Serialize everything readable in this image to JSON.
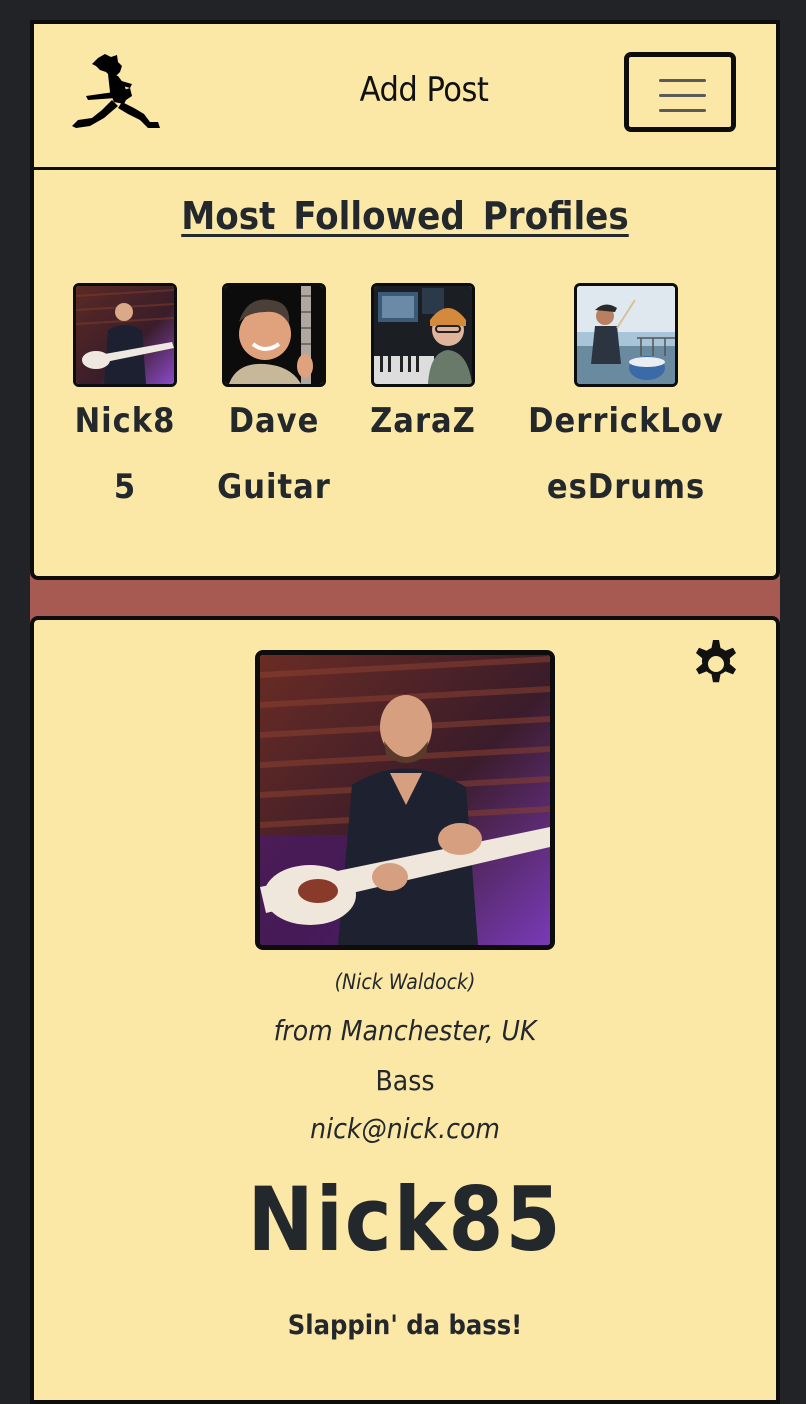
{
  "navbar": {
    "logo_icon": "jumping-guitarist-logo-icon",
    "add_post_label": "Add Post",
    "menu_icon": "hamburger-menu-icon"
  },
  "popular_profiles": {
    "title": "Most Followed Profiles",
    "profiles": [
      {
        "name": "Nick85",
        "image": "bass-player-avatar"
      },
      {
        "name": "DaveGuitar",
        "image": "guitarist-avatar"
      },
      {
        "name": "ZaraZ",
        "image": "producer-avatar"
      },
      {
        "name": "DerrickLovesDrums",
        "image": "drummer-avatar"
      }
    ]
  },
  "profile": {
    "settings_icon": "gear-icon",
    "image": "bass-player-photo",
    "real_name": "(Nick Waldock)",
    "location": "from Manchester, UK",
    "instrument": "Bass",
    "email": "nick@nick.com",
    "username": "Nick85",
    "bio": "Slappin' da bass!"
  },
  "colors": {
    "page_bg": "#222326",
    "card_bg": "#fbe7a6",
    "separator": "#a65a52",
    "border": "#0d0d0d",
    "text": "#23282d"
  }
}
